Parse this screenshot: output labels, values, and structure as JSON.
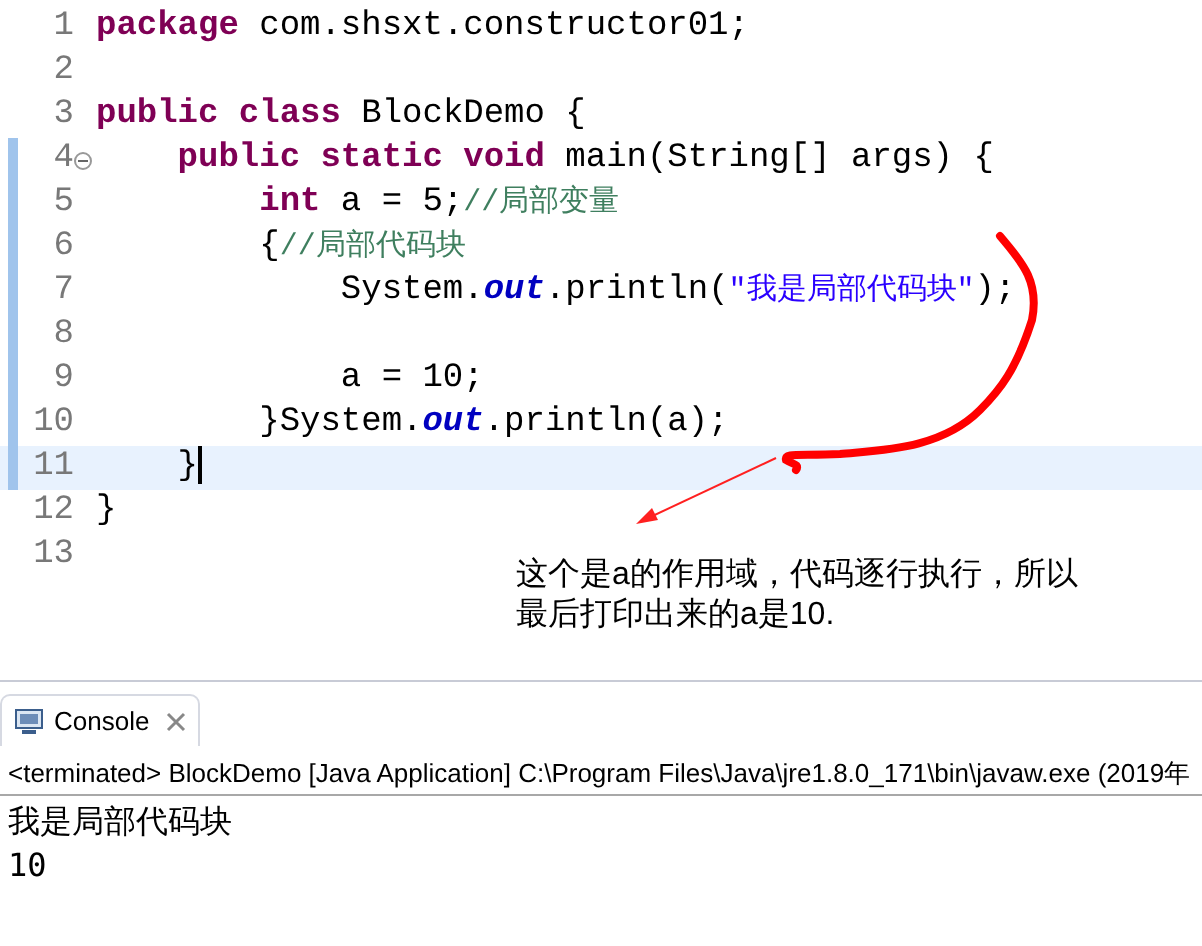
{
  "editor": {
    "lines": [
      {
        "number": "1",
        "changed": false,
        "foldable": false,
        "current": false,
        "tokens": [
          {
            "kind": "keyword",
            "text": "package"
          },
          {
            "kind": "plain",
            "text": " com.shsxt.constructor01;"
          }
        ]
      },
      {
        "number": "2",
        "changed": false,
        "foldable": false,
        "current": false
      },
      {
        "number": "3",
        "changed": false,
        "foldable": false,
        "current": false,
        "tokens": [
          {
            "kind": "keyword",
            "text": "public"
          },
          {
            "kind": "keyword",
            "text": " class"
          },
          {
            "kind": "plain",
            "text": " BlockDemo {"
          }
        ]
      },
      {
        "number": "4",
        "changed": true,
        "foldable": true,
        "current": false,
        "tokens": [
          {
            "kind": "keyword",
            "text": "    public"
          },
          {
            "kind": "keyword",
            "text": " static"
          },
          {
            "kind": "keyword",
            "text": " void"
          },
          {
            "kind": "plain",
            "text": " main(String[] args) {"
          }
        ]
      },
      {
        "number": "5",
        "changed": true,
        "foldable": false,
        "current": false,
        "tokens": [
          {
            "kind": "keyword",
            "text": "        int"
          },
          {
            "kind": "plain",
            "text": " a = 5;"
          },
          {
            "kind": "comment",
            "text": "//局部变量"
          }
        ]
      },
      {
        "number": "6",
        "changed": true,
        "foldable": false,
        "current": false,
        "tokens": [
          {
            "kind": "plain",
            "text": "        {"
          },
          {
            "kind": "comment",
            "text": "//局部代码块"
          }
        ]
      },
      {
        "number": "7",
        "changed": true,
        "foldable": false,
        "current": false,
        "tokens": [
          {
            "kind": "plain",
            "text": "            System."
          },
          {
            "kind": "field",
            "text": "out"
          },
          {
            "kind": "plain",
            "text": ".println("
          },
          {
            "kind": "string",
            "text": "\"我是局部代码块\""
          },
          {
            "kind": "plain",
            "text": ");"
          }
        ]
      },
      {
        "number": "8",
        "changed": true,
        "foldable": false,
        "current": false
      },
      {
        "number": "9",
        "changed": true,
        "foldable": false,
        "current": false,
        "tokens": [
          {
            "kind": "plain",
            "text": "            a = 10;"
          }
        ]
      },
      {
        "number": "10",
        "changed": true,
        "foldable": false,
        "current": false,
        "tokens": [
          {
            "kind": "plain",
            "text": "        }System."
          },
          {
            "kind": "field",
            "text": "out"
          },
          {
            "kind": "plain",
            "text": ".println(a);"
          }
        ]
      },
      {
        "number": "11",
        "changed": true,
        "foldable": false,
        "current": true,
        "tokens": [
          {
            "kind": "plain",
            "text": "    }"
          }
        ]
      },
      {
        "number": "12",
        "changed": false,
        "foldable": false,
        "current": false,
        "tokens": [
          {
            "kind": "plain",
            "text": "}"
          }
        ]
      },
      {
        "number": "13",
        "changed": false,
        "foldable": false,
        "current": false
      }
    ]
  },
  "annotation": {
    "lines": [
      "这个是a的作用域，代码逐行执行，所以",
      "最后打印出来的a是10."
    ]
  },
  "console": {
    "tab": {
      "label": "Console",
      "selected": true
    },
    "header": "<terminated> BlockDemo [Java Application] C:\\Program Files\\Java\\jre1.8.0_171\\bin\\javaw.exe (2019年",
    "output": [
      "我是局部代码块",
      "10"
    ]
  }
}
